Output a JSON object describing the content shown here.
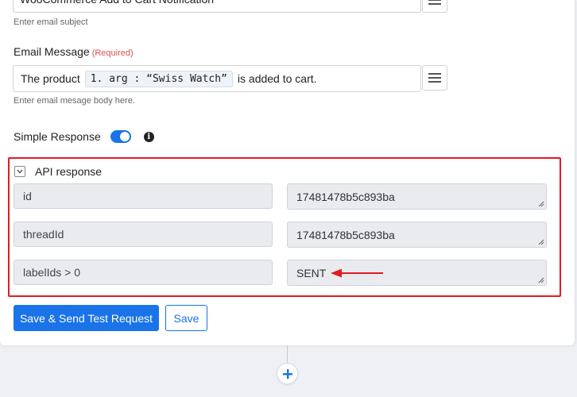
{
  "subject": {
    "value": "WooCommerce Add to Cart Notification",
    "hint": "Enter email subject"
  },
  "message": {
    "label": "Email Message",
    "required": "(Required)",
    "prefix": "The product",
    "chip": "1. arg : “Swiss Watch”",
    "suffix": "is added to cart.",
    "hint": "Enter email mesage body here."
  },
  "simple_response": {
    "label": "Simple Response",
    "enabled": true
  },
  "api_response": {
    "title": "API response",
    "rows": [
      {
        "key": "id",
        "value": "17481478b5c893ba"
      },
      {
        "key": "threadId",
        "value": "17481478b5c893ba"
      },
      {
        "key": "labelIds > 0",
        "value": "SENT"
      }
    ]
  },
  "actions": {
    "save_send": "Save & Send Test Request",
    "save": "Save"
  },
  "colors": {
    "accent": "#1a73e8",
    "highlight_border": "#e31b23",
    "required": "#d9534f"
  },
  "icons": {
    "menu": "hamburger-menu-icon",
    "info": "info-icon",
    "chevron": "chevron-down-icon",
    "arrow": "red-arrow-icon",
    "add": "plus-icon"
  }
}
